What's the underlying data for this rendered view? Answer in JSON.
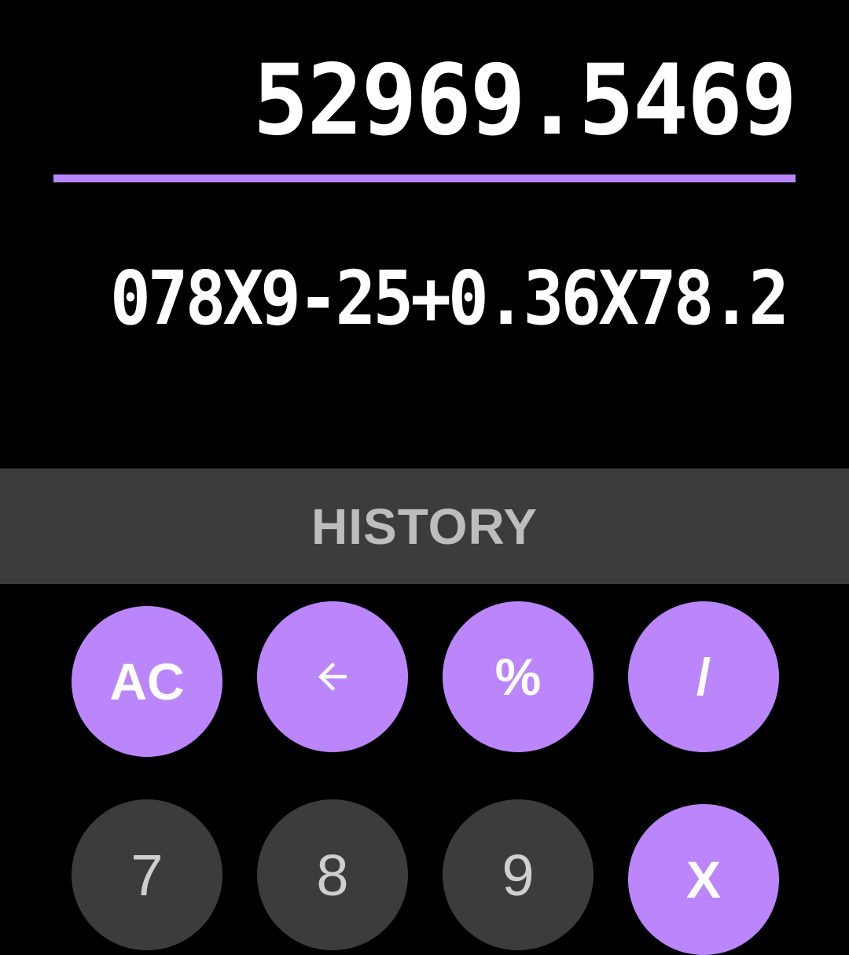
{
  "display": {
    "result": "52969.5469",
    "expression": "078X9-25+0.36X78.2"
  },
  "history": {
    "label": "HISTORY"
  },
  "keypad": {
    "row1": {
      "clear": "AC",
      "backspace_icon": "arrow-left-icon",
      "percent": "%",
      "divide": "/"
    },
    "row2": {
      "seven": "7",
      "eight": "8",
      "nine": "9",
      "multiply": "X"
    }
  },
  "colors": {
    "accent": "#BB86FC",
    "background": "#000000",
    "key_dark": "#3C3C3C",
    "history_bg": "#3C3C3C",
    "history_text": "#BDBDBD"
  }
}
